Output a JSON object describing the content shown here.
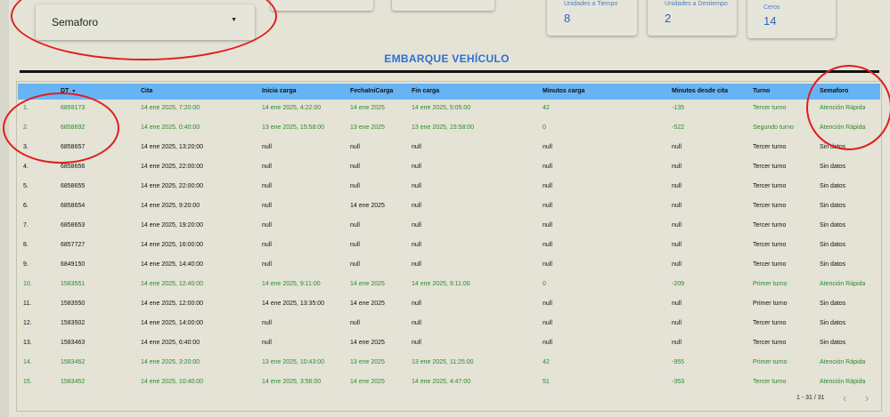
{
  "filter": {
    "label": "Semaforo"
  },
  "kpis": [
    {
      "label": "Unidades a Tiempo",
      "value": "8"
    },
    {
      "label": "Unidades a Destiempo",
      "value": "2"
    },
    {
      "label": "Ceros",
      "value": "14"
    }
  ],
  "section": {
    "title": "EMBARQUE VEHÍCULO"
  },
  "table": {
    "columns": [
      "DT",
      "Cita",
      "Inicia carga",
      "FechaIniCarga",
      "Fin carga",
      "Minutos carga",
      "Minutos desde cita",
      "Turno",
      "Semaforo"
    ],
    "rows": [
      {
        "idx": "1.",
        "dt": "6859173",
        "cita": "14 ene 2025, 7:20:00",
        "inicia": "14 ene 2025, 4:22:00",
        "fecha": "14 ene 2025",
        "fin": "14 ene 2025, 5:05:00",
        "min": "42",
        "desde": "-135",
        "turno": "Tercer turno",
        "sem": "Atención Rápida"
      },
      {
        "idx": "2.",
        "dt": "6858692",
        "cita": "14 ene 2025, 0:40:00",
        "inicia": "13 ene 2025, 15:58:00",
        "fecha": "13 ene 2025",
        "fin": "13 ene 2025, 15:58:00",
        "min": "0",
        "desde": "-522",
        "turno": "Segundo turno",
        "sem": "Atención Rápida"
      },
      {
        "idx": "3.",
        "dt": "6858657",
        "cita": "14 ene 2025, 13:20:00",
        "inicia": "null",
        "fecha": "null",
        "fin": "null",
        "min": "null",
        "desde": "null",
        "turno": "Tercer turno",
        "sem": "Sin datos"
      },
      {
        "idx": "4.",
        "dt": "6858656",
        "cita": "14 ene 2025, 22:00:00",
        "inicia": "null",
        "fecha": "null",
        "fin": "null",
        "min": "null",
        "desde": "null",
        "turno": "Tercer turno",
        "sem": "Sin datos"
      },
      {
        "idx": "5.",
        "dt": "6858655",
        "cita": "14 ene 2025, 22:00:00",
        "inicia": "null",
        "fecha": "null",
        "fin": "null",
        "min": "null",
        "desde": "null",
        "turno": "Tercer turno",
        "sem": "Sin datos"
      },
      {
        "idx": "6.",
        "dt": "6858654",
        "cita": "14 ene 2025, 9:20:00",
        "inicia": "null",
        "fecha": "14 ene 2025",
        "fin": "null",
        "min": "null",
        "desde": "null",
        "turno": "Tercer turno",
        "sem": "Sin datos"
      },
      {
        "idx": "7.",
        "dt": "6858653",
        "cita": "14 ene 2025, 19:20:00",
        "inicia": "null",
        "fecha": "null",
        "fin": "null",
        "min": "null",
        "desde": "null",
        "turno": "Tercer turno",
        "sem": "Sin datos"
      },
      {
        "idx": "8.",
        "dt": "6857727",
        "cita": "14 ene 2025, 16:00:00",
        "inicia": "null",
        "fecha": "null",
        "fin": "null",
        "min": "null",
        "desde": "null",
        "turno": "Tercer turno",
        "sem": "Sin datos"
      },
      {
        "idx": "9.",
        "dt": "6849150",
        "cita": "14 ene 2025, 14:40:00",
        "inicia": "null",
        "fecha": "null",
        "fin": "null",
        "min": "null",
        "desde": "null",
        "turno": "Tercer turno",
        "sem": "Sin datos"
      },
      {
        "idx": "10.",
        "dt": "1583551",
        "cita": "14 ene 2025, 12:40:00",
        "inicia": "14 ene 2025, 9:11:00",
        "fecha": "14 ene 2025",
        "fin": "14 ene 2025, 9:11:00",
        "min": "0",
        "desde": "-209",
        "turno": "Primer turno",
        "sem": "Atención Rápida"
      },
      {
        "idx": "11.",
        "dt": "1583550",
        "cita": "14 ene 2025, 12:00:00",
        "inicia": "14 ene 2025, 13:35:00",
        "fecha": "14 ene 2025",
        "fin": "null",
        "min": "null",
        "desde": "null",
        "turno": "Primer turno",
        "sem": "Sin datos"
      },
      {
        "idx": "12.",
        "dt": "1583502",
        "cita": "14 ene 2025, 14:00:00",
        "inicia": "null",
        "fecha": "null",
        "fin": "null",
        "min": "null",
        "desde": "null",
        "turno": "Tercer turno",
        "sem": "Sin datos"
      },
      {
        "idx": "13.",
        "dt": "1583463",
        "cita": "14 ene 2025, 6:40:00",
        "inicia": "null",
        "fecha": "14 ene 2025",
        "fin": "null",
        "min": "null",
        "desde": "null",
        "turno": "Tercer turno",
        "sem": "Sin datos"
      },
      {
        "idx": "14.",
        "dt": "1583462",
        "cita": "14 ene 2025, 3:20:00",
        "inicia": "13 ene 2025, 10:43:00",
        "fecha": "13 ene 2025",
        "fin": "13 ene 2025, 11:25:00",
        "min": "42",
        "desde": "-955",
        "turno": "Primer turno",
        "sem": "Atención Rápida"
      },
      {
        "idx": "15.",
        "dt": "1583452",
        "cita": "14 ene 2025, 10:40:00",
        "inicia": "14 ene 2025, 3:56:00",
        "fecha": "14 ene 2025",
        "fin": "14 ene 2025, 4:47:00",
        "min": "51",
        "desde": "-353",
        "turno": "Tercer turno",
        "sem": "Atención Rápida"
      }
    ]
  },
  "pagination": {
    "label": "1 - 31 / 31"
  },
  "colors": {
    "header_blue": "#67b4f5",
    "green_text": "#2b8a2b",
    "title_blue": "#2e6fd1",
    "annotation_red": "#e11d1d"
  }
}
